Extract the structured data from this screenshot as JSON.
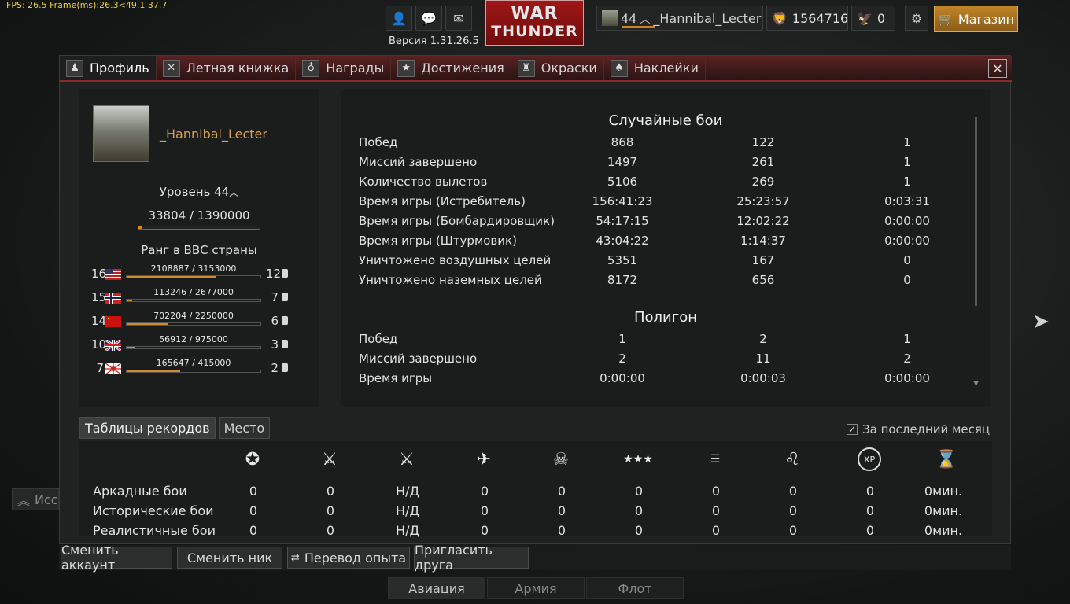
{
  "fps": "FPS: 26.5 Frame(ms):26.3<49.1 37.7",
  "version": "Версия 1.31.26.5",
  "logo": {
    "line1": "WAR",
    "line2": "THUNDER"
  },
  "topbar": {
    "player_level": "44",
    "player_name": "_Hannibal_Lecter",
    "silver_lions": "1564716",
    "golden_eagles": "0",
    "shop_label": "Магазин"
  },
  "tabs": [
    {
      "label": "Профиль",
      "icon": "profile-icon"
    },
    {
      "label": "Летная книжка",
      "icon": "logbook-icon"
    },
    {
      "label": "Награды",
      "icon": "medal-icon"
    },
    {
      "label": "Достижения",
      "icon": "star-icon"
    },
    {
      "label": "Окраски",
      "icon": "skin-icon"
    },
    {
      "label": "Наклейки",
      "icon": "decal-icon"
    }
  ],
  "profile": {
    "nick": "_Hannibal_Lecter",
    "level_label": "Уровень 44",
    "xp": "33804 / 1390000",
    "xp_fraction": 0.024,
    "rank_title": "Ранг в ВВС страны",
    "nations": [
      {
        "rank": "16",
        "points": "2108887 / 3153000",
        "fraction": 0.669,
        "tier": "12",
        "flag": "usa"
      },
      {
        "rank": "15",
        "points": "113246 / 2677000",
        "fraction": 0.042,
        "tier": "7",
        "flag": "norway"
      },
      {
        "rank": "14",
        "points": "702204 / 2250000",
        "fraction": 0.312,
        "tier": "6",
        "flag": "ussr"
      },
      {
        "rank": "10",
        "points": "56912 / 975000",
        "fraction": 0.058,
        "tier": "3",
        "flag": "uk"
      },
      {
        "rank": "7",
        "points": "165647 / 415000",
        "fraction": 0.399,
        "tier": "2",
        "flag": "japan"
      }
    ]
  },
  "stats": {
    "random_title": "Случайные бои",
    "random_rows": [
      {
        "label": "Побед",
        "c1": "868",
        "c2": "122",
        "c3": "1"
      },
      {
        "label": "Миссий завершено",
        "c1": "1497",
        "c2": "261",
        "c3": "1"
      },
      {
        "label": "Количество вылетов",
        "c1": "5106",
        "c2": "269",
        "c3": "1"
      },
      {
        "label": "Время игры (Истребитель)",
        "c1": "156:41:23",
        "c2": "25:23:57",
        "c3": "0:03:31"
      },
      {
        "label": "Время игры (Бомбардировщик)",
        "c1": "54:17:15",
        "c2": "12:02:22",
        "c3": "0:00:00"
      },
      {
        "label": "Время игры (Штурмовик)",
        "c1": "43:04:22",
        "c2": "1:14:37",
        "c3": "0:00:00"
      },
      {
        "label": "Уничтожено воздушных целей",
        "c1": "5351",
        "c2": "167",
        "c3": "0"
      },
      {
        "label": "Уничтожено наземных целей",
        "c1": "8172",
        "c2": "656",
        "c3": "0"
      }
    ],
    "polygon_title": "Полигон",
    "polygon_rows": [
      {
        "label": "Побед",
        "c1": "1",
        "c2": "2",
        "c3": "1"
      },
      {
        "label": "Миссий завершено",
        "c1": "2",
        "c2": "11",
        "c3": "2"
      },
      {
        "label": "Время игры",
        "c1": "0:00:00",
        "c2": "0:00:03",
        "c3": "0:00:00"
      }
    ]
  },
  "leaderboard": {
    "tab_records": "Таблицы рекордов",
    "tab_place": "Место",
    "last_month": "За последний месяц",
    "icons": [
      "victories-icon",
      "crossed-swords-icon",
      "swords-ratio-icon",
      "air-kills-icon",
      "skull-icon",
      "stars-icon",
      "ribbons-icon",
      "lion-icon",
      "xp-icon",
      "hourglass-icon"
    ],
    "xp_icon_text": "XP",
    "rows": [
      {
        "label": "Аркадные бои",
        "values": [
          "0",
          "0",
          "Н/Д",
          "0",
          "0",
          "0",
          "0",
          "0",
          "0",
          "0мин."
        ]
      },
      {
        "label": "Исторические бои",
        "values": [
          "0",
          "0",
          "Н/Д",
          "0",
          "0",
          "0",
          "0",
          "0",
          "0",
          "0мин."
        ]
      },
      {
        "label": "Реалистичные бои",
        "values": [
          "0",
          "0",
          "Н/Д",
          "0",
          "0",
          "0",
          "0",
          "0",
          "0",
          "0мин."
        ]
      }
    ]
  },
  "bottom_buttons": {
    "change_account": "Сменить аккаунт",
    "change_nick": "Сменить ник",
    "transfer_xp": "Перевод опыта",
    "invite_friend": "Пригласить друга"
  },
  "behind": {
    "aviation": "Авиация",
    "army": "Армия",
    "fleet": "Флот",
    "left_label": "Исс"
  }
}
